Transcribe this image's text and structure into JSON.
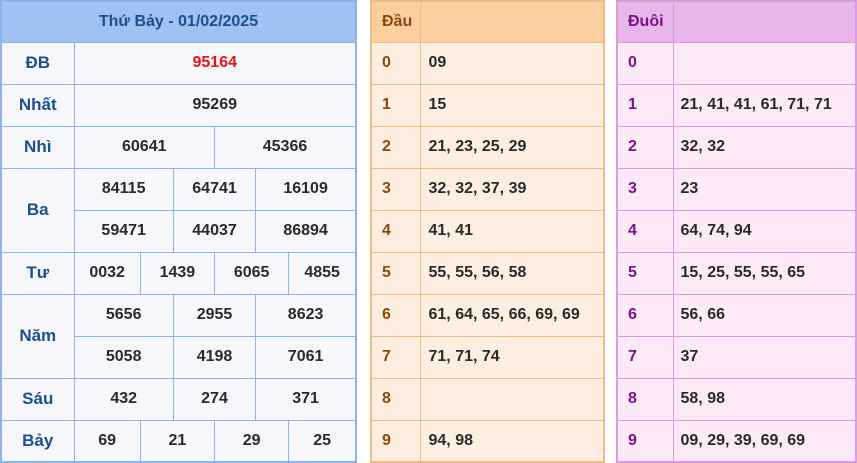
{
  "results": {
    "title": "Thứ Bảy - 01/02/2025",
    "prizes": {
      "db": {
        "label": "ĐB",
        "values": [
          "95164"
        ]
      },
      "nhat": {
        "label": "Nhất",
        "values": [
          "95269"
        ]
      },
      "nhi": {
        "label": "Nhì",
        "values": [
          "60641",
          "45366"
        ]
      },
      "ba": {
        "label": "Ba",
        "values": [
          "84115",
          "64741",
          "16109",
          "59471",
          "44037",
          "86894"
        ]
      },
      "tu": {
        "label": "Tư",
        "values": [
          "0032",
          "1439",
          "6065",
          "4855"
        ]
      },
      "nam": {
        "label": "Năm",
        "values": [
          "5656",
          "2955",
          "8623",
          "5058",
          "4198",
          "7061"
        ]
      },
      "sau": {
        "label": "Sáu",
        "values": [
          "432",
          "274",
          "371"
        ]
      },
      "bay": {
        "label": "Bảy",
        "values": [
          "69",
          "21",
          "29",
          "25"
        ]
      }
    }
  },
  "dau": {
    "title": "Đầu",
    "rows": [
      {
        "key": "0",
        "value": "09"
      },
      {
        "key": "1",
        "value": "15"
      },
      {
        "key": "2",
        "value": "21, 23, 25, 29"
      },
      {
        "key": "3",
        "value": "32, 32, 37, 39"
      },
      {
        "key": "4",
        "value": "41, 41"
      },
      {
        "key": "5",
        "value": "55, 55, 56, 58"
      },
      {
        "key": "6",
        "value": "61, 64, 65, 66, 69, 69"
      },
      {
        "key": "7",
        "value": "71, 71, 74"
      },
      {
        "key": "8",
        "value": ""
      },
      {
        "key": "9",
        "value": "94, 98"
      }
    ]
  },
  "duoi": {
    "title": "Đuôi",
    "rows": [
      {
        "key": "0",
        "value": ""
      },
      {
        "key": "1",
        "value": "21, 41, 41, 61, 71, 71"
      },
      {
        "key": "2",
        "value": "32, 32"
      },
      {
        "key": "3",
        "value": "23"
      },
      {
        "key": "4",
        "value": "64, 74, 94"
      },
      {
        "key": "5",
        "value": "15, 25, 55, 55, 65"
      },
      {
        "key": "6",
        "value": "56, 66"
      },
      {
        "key": "7",
        "value": "37"
      },
      {
        "key": "8",
        "value": "58, 98"
      },
      {
        "key": "9",
        "value": "09, 29, 39, 69, 69"
      }
    ]
  },
  "colors": {
    "special_prize": "#e8141b",
    "results_accent": "#9fc2f3",
    "dau_accent": "#fbcfa2",
    "duoi_accent": "#e8b6ea"
  }
}
